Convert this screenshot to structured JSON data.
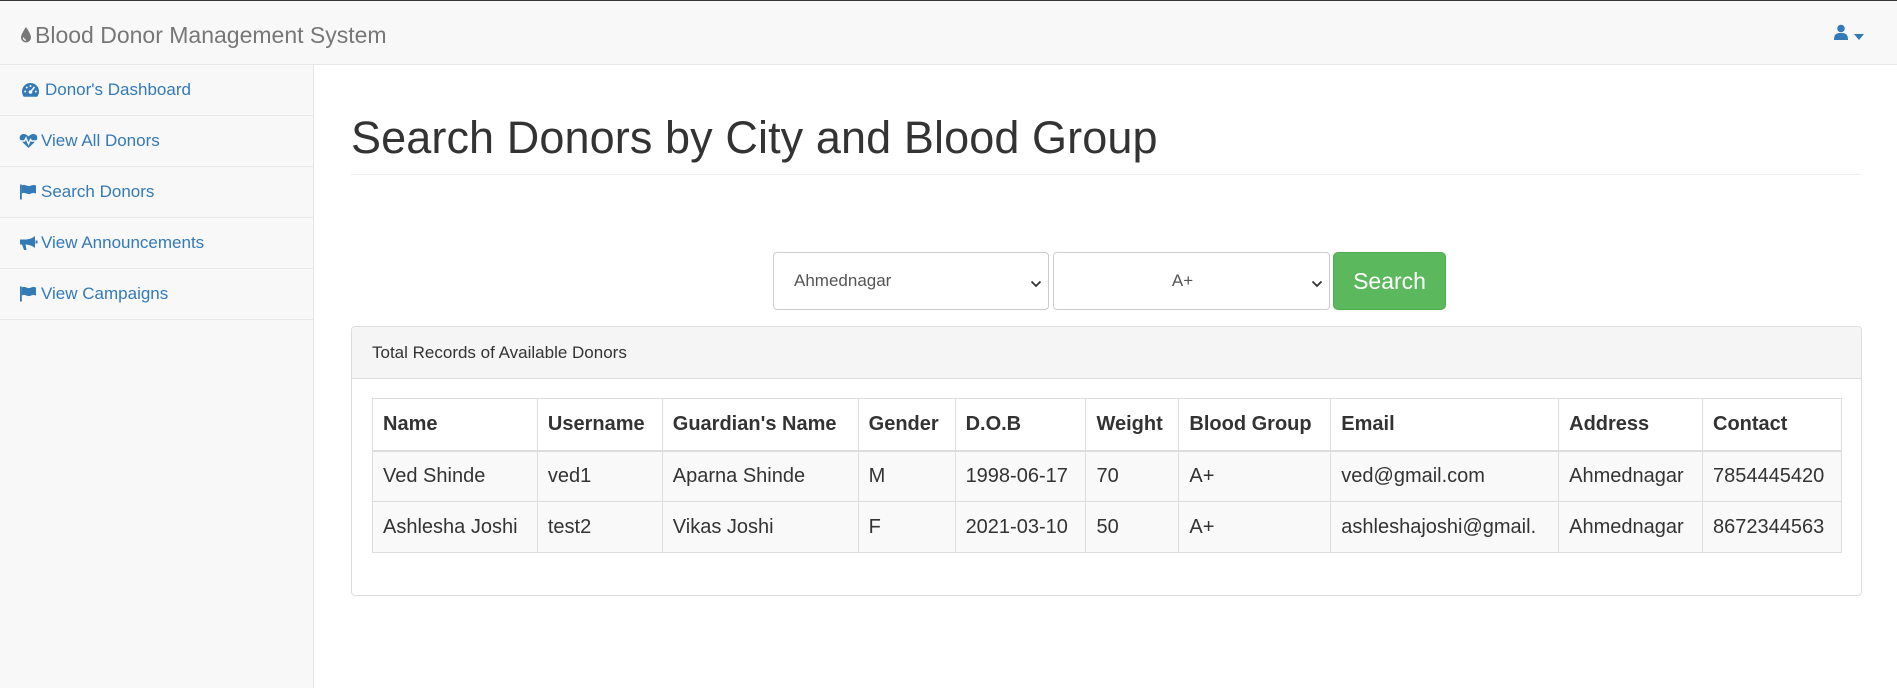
{
  "navbar": {
    "brand": "Blood Donor Management System",
    "brand_icon": "tint-icon",
    "user_icon": "user-icon"
  },
  "sidebar": {
    "items": [
      {
        "label": "Donor's Dashboard",
        "icon": "dashboard-icon"
      },
      {
        "label": "View All Donors",
        "icon": "heartbeat-icon"
      },
      {
        "label": "Search Donors",
        "icon": "flag-icon"
      },
      {
        "label": "View Announcements",
        "icon": "bullhorn-icon"
      },
      {
        "label": "View Campaigns",
        "icon": "flag-icon"
      }
    ]
  },
  "main": {
    "title": "Search Donors by City and Blood Group",
    "search": {
      "city_value": "Ahmednagar",
      "group_value": "A+",
      "button_label": "Search"
    },
    "panel": {
      "heading": "Total Records of Available Donors",
      "columns": [
        "Name",
        "Username",
        "Guardian's Name",
        "Gender",
        "D.O.B",
        "Weight",
        "Blood Group",
        "Email",
        "Address",
        "Contact"
      ],
      "rows": [
        [
          "Ved Shinde",
          "ved1",
          "Aparna Shinde",
          "M",
          "1998-06-17",
          "70",
          "A+",
          "ved@gmail.com",
          "Ahmednagar",
          "7854445420"
        ],
        [
          "Ashlesha Joshi",
          "test2",
          "Vikas Joshi",
          "F",
          "2021-03-10",
          "50",
          "A+",
          "ashleshajoshi@gmail.",
          "Ahmednagar",
          "8672344563"
        ]
      ]
    }
  },
  "colors": {
    "link": "#337ab7",
    "success": "#5cb85c",
    "navbar_bg": "#f8f8f8"
  }
}
